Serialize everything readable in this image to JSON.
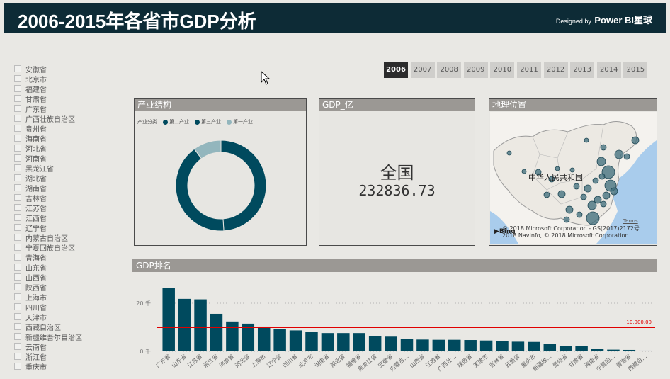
{
  "header": {
    "title": "2006-2015年各省市GDP分析",
    "credit_small": "Designed by",
    "credit_big": "Power BI星球",
    "bg_color": "#0d2b36"
  },
  "slicer": {
    "provinces": [
      "安徽省",
      "北京市",
      "福建省",
      "甘肃省",
      "广东省",
      "广西壮族自治区",
      "贵州省",
      "海南省",
      "河北省",
      "河南省",
      "黑龙江省",
      "湖北省",
      "湖南省",
      "吉林省",
      "江苏省",
      "江西省",
      "辽宁省",
      "内蒙古自治区",
      "宁夏回族自治区",
      "青海省",
      "山东省",
      "山西省",
      "陕西省",
      "上海市",
      "四川省",
      "天津市",
      "西藏自治区",
      "新疆维吾尔自治区",
      "云南省",
      "浙江省",
      "重庆市"
    ]
  },
  "years": {
    "items": [
      "2006",
      "2007",
      "2008",
      "2009",
      "2010",
      "2011",
      "2012",
      "2013",
      "2014",
      "2015"
    ],
    "selected": "2006"
  },
  "industry": {
    "title": "产业结构",
    "legend_label": "产业分类",
    "series": [
      {
        "name": "第二产业",
        "share": 0.49,
        "color": "#004a5e"
      },
      {
        "name": "第三产业",
        "share": 0.41,
        "color": "#004a5e"
      },
      {
        "name": "第一产业",
        "share": 0.1,
        "color": "#93b6bd"
      }
    ]
  },
  "gdp_card": {
    "title": "GDP_亿",
    "name": "全国",
    "value": "232836.73"
  },
  "map": {
    "title": "地理位置",
    "label": "中华人民共和国",
    "copyright_line1": "© 2018 Microsoft Corporation - GS(2017)2172号",
    "copyright_line2": "2018 NavInfo, © 2018 Microsoft Corporation",
    "terms": "Terms",
    "bing": "Bing"
  },
  "ranking": {
    "title": "GDP排名"
  },
  "chart_data": {
    "type": "bar",
    "categories": [
      "广东省",
      "山东省",
      "江苏省",
      "浙江省",
      "河南省",
      "河北省",
      "上海市",
      "辽宁省",
      "四川省",
      "北京市",
      "湖南省",
      "湖北省",
      "福建省",
      "黑龙江省",
      "安徽省",
      "内蒙古...",
      "山西省",
      "江西省",
      "广西壮...",
      "陕西省",
      "天津市",
      "吉林省",
      "云南省",
      "重庆市",
      "新疆维...",
      "贵州省",
      "甘肃省",
      "海南省",
      "宁夏回...",
      "青海省",
      "西藏自..."
    ],
    "values": [
      26.2,
      21.8,
      21.6,
      15.6,
      12.4,
      11.5,
      10.3,
      9.3,
      8.7,
      8.1,
      7.6,
      7.6,
      7.6,
      6.3,
      6.1,
      5.0,
      4.9,
      4.8,
      4.8,
      4.7,
      4.5,
      4.3,
      4.0,
      3.9,
      3.0,
      2.3,
      2.3,
      1.1,
      0.7,
      0.6,
      0.3
    ],
    "reference_line": {
      "value": 10,
      "label": "10,000.00",
      "color": "#e00000"
    },
    "y_ticks": [
      {
        "value": 0,
        "label": "0 千"
      },
      {
        "value": 20,
        "label": "20 千"
      }
    ],
    "ylim": [
      0,
      30
    ],
    "bar_color": "#004a5e"
  }
}
